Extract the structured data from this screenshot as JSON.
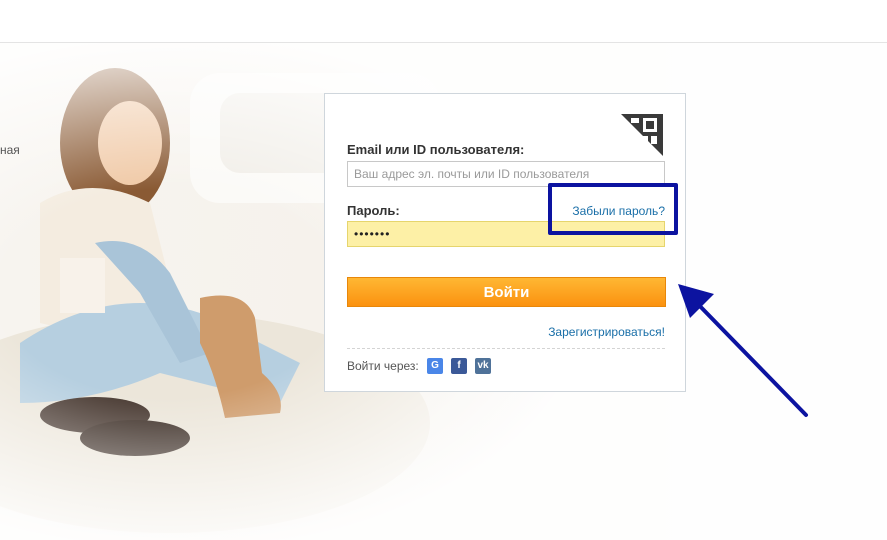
{
  "side_text": "ная",
  "login": {
    "email_label": "Email или ID пользователя:",
    "email_placeholder": "Ваш адрес эл. почты или ID пользователя",
    "password_label": "Пароль:",
    "password_value": "•••••••",
    "forgot_link": "Забыли пароль?",
    "submit_label": "Войти",
    "register_link": "Зарегистрироваться!",
    "social_label": "Войти через:",
    "social": [
      {
        "name": "google",
        "glyph": "G"
      },
      {
        "name": "facebook",
        "glyph": "f"
      },
      {
        "name": "vk",
        "glyph": "vk"
      }
    ]
  },
  "colors": {
    "accent_orange": "#fb9210",
    "link_blue": "#1a6fa8",
    "annotation_blue": "#0c13a0",
    "password_bg": "#fdf0a6"
  }
}
